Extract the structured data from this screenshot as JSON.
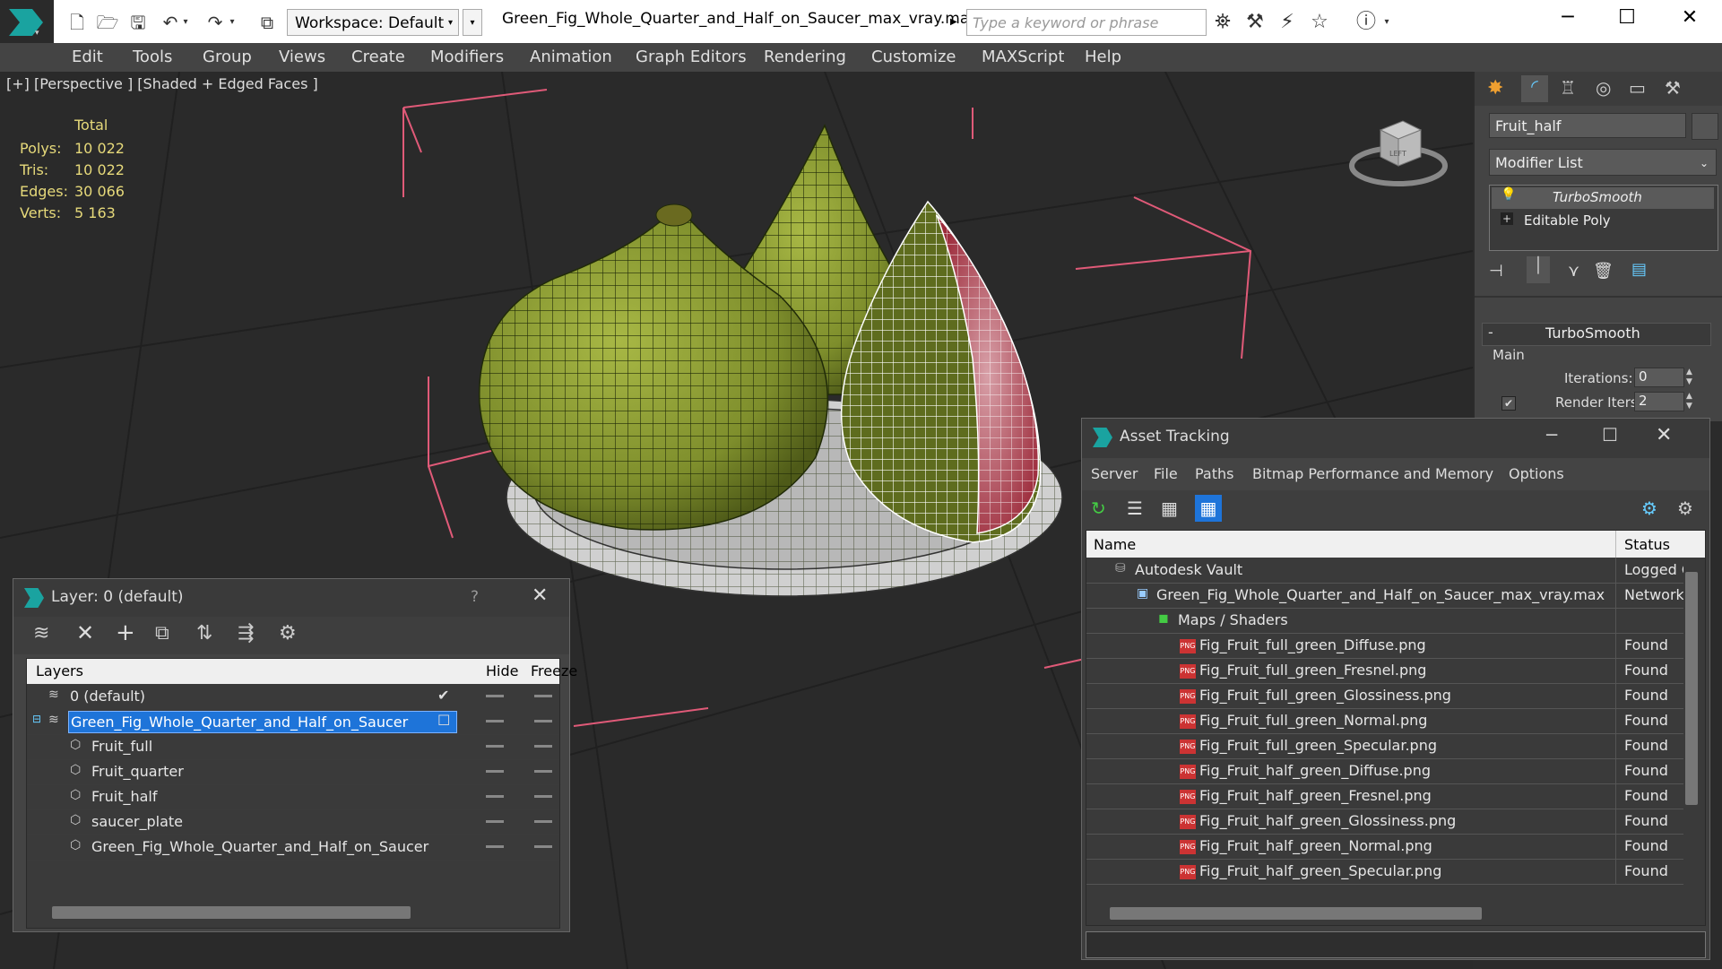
{
  "app": {
    "document_title": "Green_Fig_Whole_Quarter_and_Half_on_Saucer_max_vray.max",
    "workspace_label": "Workspace: Default",
    "search_placeholder": "Type a keyword or phrase"
  },
  "menu": [
    "Edit",
    "Tools",
    "Group",
    "Views",
    "Create",
    "Modifiers",
    "Animation",
    "Graph Editors",
    "Rendering",
    "Customize",
    "MAXScript",
    "Help"
  ],
  "viewport": {
    "label": "[+] [Perspective ] [Shaded + Edged Faces ]",
    "stats_header": "Total",
    "stats": [
      {
        "label": "Polys:",
        "value": "10 022"
      },
      {
        "label": "Tris:",
        "value": "10 022"
      },
      {
        "label": "Edges:",
        "value": "30 066"
      },
      {
        "label": "Verts:",
        "value": "5 163"
      }
    ],
    "viewcube_label": "LEFT"
  },
  "command_panel": {
    "object_name": "Fruit_half",
    "modifier_list_label": "Modifier List",
    "stack": [
      "TurboSmooth",
      "Editable Poly"
    ],
    "rollout_title": "TurboSmooth",
    "group_label": "Main",
    "iterations_label": "Iterations:",
    "iterations_value": "0",
    "render_iters_label": "Render Iters:",
    "render_iters_value": "2",
    "render_iters_checked": true
  },
  "layer_window": {
    "title": "Layer: 0 (default)",
    "help": "?",
    "columns": [
      "Layers",
      "Hide",
      "Freeze"
    ],
    "rows": [
      {
        "name": "0 (default)",
        "indent": 0,
        "type": "layer",
        "checked": true
      },
      {
        "name": "Green_Fig_Whole_Quarter_and_Half_on_Saucer",
        "indent": 0,
        "type": "layer",
        "selected": true,
        "expandable": true
      },
      {
        "name": "Fruit_full",
        "indent": 1,
        "type": "object"
      },
      {
        "name": "Fruit_quarter",
        "indent": 1,
        "type": "object"
      },
      {
        "name": "Fruit_half",
        "indent": 1,
        "type": "object"
      },
      {
        "name": "saucer_plate",
        "indent": 1,
        "type": "object"
      },
      {
        "name": "Green_Fig_Whole_Quarter_and_Half_on_Saucer",
        "indent": 1,
        "type": "object"
      }
    ]
  },
  "asset_window": {
    "title": "Asset Tracking",
    "menu": [
      "Server",
      "File",
      "Paths",
      "Bitmap Performance and Memory",
      "Options"
    ],
    "columns": [
      "Name",
      "Status"
    ],
    "rows": [
      {
        "name": "Autodesk Vault",
        "status": "Logged O",
        "indent": 1,
        "icon": "vault"
      },
      {
        "name": "Green_Fig_Whole_Quarter_and_Half_on_Saucer_max_vray.max",
        "status": "Network",
        "indent": 2,
        "icon": "max"
      },
      {
        "name": "Maps / Shaders",
        "status": "",
        "indent": 3,
        "icon": "maps"
      },
      {
        "name": "Fig_Fruit_full_green_Diffuse.png",
        "status": "Found",
        "indent": 4,
        "icon": "png"
      },
      {
        "name": "Fig_Fruit_full_green_Fresnel.png",
        "status": "Found",
        "indent": 4,
        "icon": "png"
      },
      {
        "name": "Fig_Fruit_full_green_Glossiness.png",
        "status": "Found",
        "indent": 4,
        "icon": "png"
      },
      {
        "name": "Fig_Fruit_full_green_Normal.png",
        "status": "Found",
        "indent": 4,
        "icon": "png"
      },
      {
        "name": "Fig_Fruit_full_green_Specular.png",
        "status": "Found",
        "indent": 4,
        "icon": "png"
      },
      {
        "name": "Fig_Fruit_half_green_Diffuse.png",
        "status": "Found",
        "indent": 4,
        "icon": "png"
      },
      {
        "name": "Fig_Fruit_half_green_Fresnel.png",
        "status": "Found",
        "indent": 4,
        "icon": "png"
      },
      {
        "name": "Fig_Fruit_half_green_Glossiness.png",
        "status": "Found",
        "indent": 4,
        "icon": "png"
      },
      {
        "name": "Fig_Fruit_half_green_Normal.png",
        "status": "Found",
        "indent": 4,
        "icon": "png"
      },
      {
        "name": "Fig_Fruit_half_green_Specular.png",
        "status": "Found",
        "indent": 4,
        "icon": "png"
      }
    ]
  },
  "colors": {
    "accent": "#1e74d9",
    "stats": "#e6d97a",
    "fig_green": "#8a9a36",
    "fig_flesh": "#9c2a3a",
    "bbox": "#e05a78"
  }
}
